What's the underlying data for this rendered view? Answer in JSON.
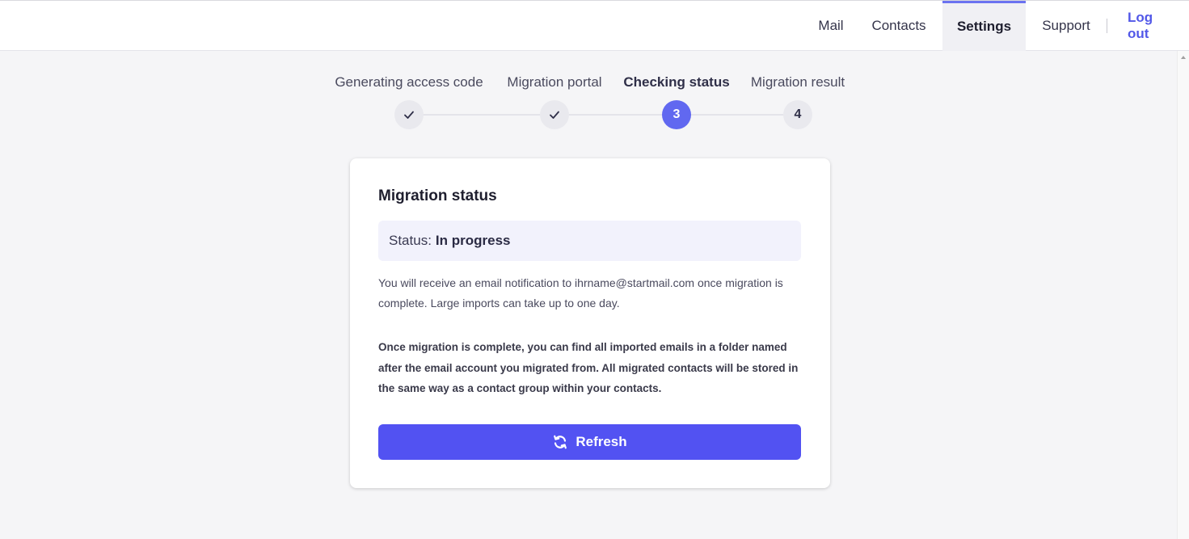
{
  "nav": {
    "mail": "Mail",
    "contacts": "Contacts",
    "settings": "Settings",
    "support": "Support",
    "logout": "Log out",
    "active": "Settings"
  },
  "steps": [
    {
      "label": "Generating access code",
      "state": "done",
      "marker": "check"
    },
    {
      "label": "Migration portal",
      "state": "done",
      "marker": "check"
    },
    {
      "label": "Checking status",
      "state": "active",
      "marker": "3"
    },
    {
      "label": "Migration result",
      "state": "pending",
      "marker": "4"
    }
  ],
  "card": {
    "title": "Migration status",
    "status_label": "Status:",
    "status_value": "In progress",
    "info": "You will receive an email notification to ihrname@startmail.com once migration is complete. Large imports can take up to one day.",
    "note": "Once migration is complete, you can find all imported emails in a folder named after the email account you migrated from. All migrated contacts will be stored in the same way as a contact group within your contacts.",
    "button_label": "Refresh"
  },
  "colors": {
    "accent": "#5252f2",
    "active_step": "#6168f0",
    "status_bg": "#f2f2fc",
    "page_bg": "#f5f5f7"
  }
}
